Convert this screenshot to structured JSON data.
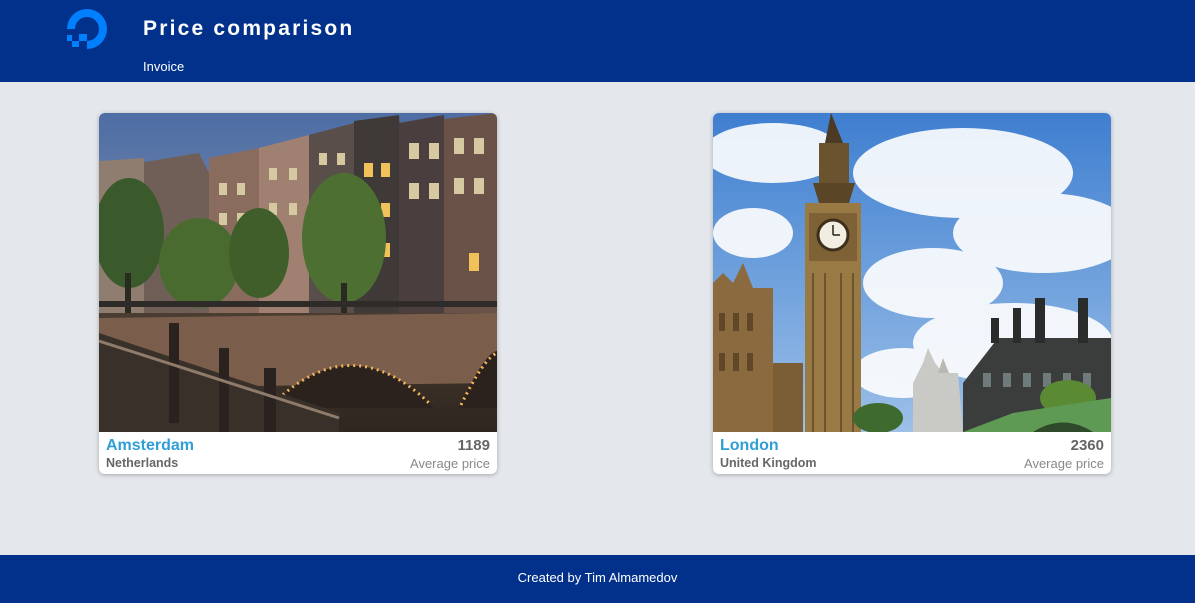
{
  "header": {
    "title": "Price comparison",
    "nav_link": "Invoice",
    "logo_icon": "digitalocean-logo-icon",
    "background_color": "#02318b",
    "logo_color": "#0080ff"
  },
  "cards": [
    {
      "city": "Amsterdam",
      "country": "Netherlands",
      "price": "1189",
      "price_label": "Average price",
      "image": "amsterdam-canal-bridge-photo"
    },
    {
      "city": "London",
      "country": "United Kingdom",
      "price": "2360",
      "price_label": "Average price",
      "image": "london-big-ben-photo"
    }
  ],
  "footer": {
    "text": "Created by Tim Almamedov"
  },
  "colors": {
    "page_background": "#e4e8ec",
    "accent_city": "#2f9fd6",
    "card_background": "#ffffff"
  }
}
